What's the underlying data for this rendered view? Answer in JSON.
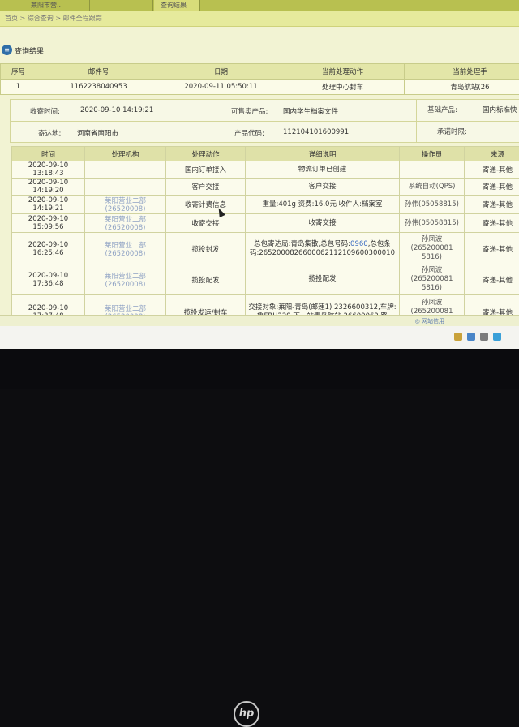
{
  "tabs": [
    "莱阳市营...",
    "",
    "查询结果"
  ],
  "breadcrumb": "首页 > 综合查询 > 邮件全程跟踪",
  "panel": {
    "title": "查询结果"
  },
  "main_table": {
    "columns": [
      "序号",
      "邮件号",
      "日期",
      "当前处理动作",
      "当前处理手"
    ],
    "row": [
      "1",
      "1162238040953",
      "2020-09-11 05:50:11",
      "处理中心封车",
      "青岛航站(26"
    ]
  },
  "info": {
    "send_time_label": "收寄时间:",
    "send_time": "2020-09-10 14:19:21",
    "sellable_label": "可售卖产品:",
    "sellable": "国内学生档案文件",
    "base_product_label": "基础产品:",
    "base_product": "国内标准快",
    "dest_label": "寄达地:",
    "dest": "河南省南阳市",
    "product_code_label": "产品代码:",
    "product_code": "112104101600991",
    "promise_label": "承诺时限:",
    "promise": ""
  },
  "tracking": {
    "columns": [
      "时间",
      "处理机构",
      "处理动作",
      "详细说明",
      "操作员",
      "来源"
    ],
    "rows": [
      {
        "time": "2020-09-10 13:18:43",
        "org": "",
        "action": "国内订单接入",
        "detail": "物流订单已创建",
        "operator": "",
        "source": "寄递-其他"
      },
      {
        "time": "2020-09-10 14:19:20",
        "org": "",
        "action": "客户交接",
        "detail": "客户交接",
        "operator": "系统自动(QPS)",
        "source": "寄递-其他"
      },
      {
        "time": "2020-09-10 14:19:21",
        "org": "莱阳营业二部 (26520008)",
        "action": "收寄计费信息",
        "detail": "重量:401g 资费:16.0元 收件人:档案室",
        "operator": "孙伟(05058815)",
        "source": "寄递-其他"
      },
      {
        "time": "2020-09-10 15:09:56",
        "org": "莱阳营业二部 (26520008)",
        "action": "收寄交接",
        "detail": "收寄交接",
        "operator": "孙伟(05058815)",
        "source": "寄递-其他"
      },
      {
        "time": "2020-09-10 16:25:46",
        "org": "莱阳营业二部 (26520008)",
        "action": "揽投封发",
        "detail_pre": "总包寄达局:青岛集散,总包号码:",
        "detail_link": "0960",
        "detail_post": ",总包条码:2652000826600062112109600300010",
        "operator": "孙凤波 (265200081 5816)",
        "source": "寄递-其他"
      },
      {
        "time": "2020-09-10 17:36:48",
        "org": "莱阳营业二部 (26520008)",
        "action": "揽投配发",
        "detail": "揽投配发",
        "operator": "孙凤波 (265200081 5816)",
        "source": "寄递-其他"
      },
      {
        "time": "2020-09-10 17:37:48",
        "org": "莱阳营业二部 (26520008)",
        "action": "揽投发运/封车",
        "detail": "交接对象:莱阳-青岛(邮速1) 2326600312,车牌:鲁FBU229,下一站青岛航站 26600062,路",
        "operator": "孙凤波 (265200081 5816)",
        "source": "寄递-其他"
      }
    ]
  },
  "statusbar": {
    "text": "◎ 网站信用"
  },
  "brand": {
    "logo_text": "hp"
  }
}
